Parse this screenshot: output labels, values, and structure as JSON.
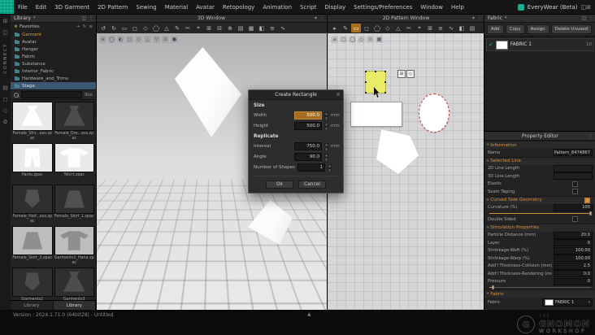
{
  "colors": {
    "accent_orange": "#d8913a",
    "brand_teal": "#0fb394",
    "selection_yellow": "#e8ec67",
    "dashed_red": "#c23a3a",
    "selection_blue": "#3b5774"
  },
  "menubar": {
    "items": [
      "File",
      "Edit",
      "3D Garment",
      "2D Pattern",
      "Sewing",
      "Material",
      "Avatar",
      "Retopology",
      "Animation",
      "Script",
      "Display",
      "Settings/Preferences",
      "Window",
      "Help"
    ],
    "app_title": "EveryWear (Beta)",
    "right_icons": [
      {
        "name": "workspace-layout",
        "glyph": "◫"
      },
      {
        "name": "window-expand",
        "glyph": "⊞"
      }
    ]
  },
  "left_rail": {
    "items": [
      {
        "name": "apps",
        "glyph": "⊞"
      },
      {
        "name": "panels",
        "glyph": "◫"
      },
      {
        "label": "CONNECT"
      },
      {
        "name": "library-rail",
        "glyph": "▤"
      },
      {
        "name": "viewport-rail",
        "glyph": "◻"
      },
      {
        "name": "assets-rail",
        "glyph": "◇"
      },
      {
        "name": "settings",
        "glyph": "⚙"
      }
    ]
  },
  "library": {
    "header": "Library",
    "header_caret": "▾",
    "header_icons": [
      {
        "name": "dock",
        "glyph": "◫"
      },
      {
        "name": "more",
        "glyph": "⋮"
      }
    ],
    "favorites_title": "Favorites",
    "favorites_icons": [
      {
        "name": "add-favorite",
        "glyph": "+"
      },
      {
        "name": "refresh",
        "glyph": "↻"
      },
      {
        "name": "list-view",
        "glyph": "≡"
      }
    ],
    "folders": [
      {
        "label": "Garment",
        "state": "active"
      },
      {
        "label": "Avatar"
      },
      {
        "label": "Hanger"
      },
      {
        "label": "Fabric"
      },
      {
        "label": "Substance"
      },
      {
        "label": "Interior_Fabric"
      },
      {
        "label": "Hardware_and_Trims"
      },
      {
        "label": "Stage",
        "state": "selected"
      }
    ],
    "search_icons": [
      {
        "name": "view-grid",
        "glyph": "⊞"
      },
      {
        "name": "sort",
        "glyph": "≡"
      }
    ],
    "items": [
      {
        "caption": "Female_Shir...ess.zpac",
        "bg": "#e9e9e9",
        "fg": "#fdfdfd",
        "shape": "dress"
      },
      {
        "caption": "Female_Dre...ess.zpac",
        "bg": "#2f2f2f",
        "fg": "#4d4d4d",
        "shape": "dress"
      },
      {
        "caption": "Pants.zpac",
        "bg": "#e9e9e9",
        "fg": "#fdfdfd",
        "shape": "pants"
      },
      {
        "caption": "Tshirt.zpac",
        "bg": "#e9e9e9",
        "fg": "#fdfdfd",
        "shape": "tee"
      },
      {
        "caption": "Female_Half...ess.zpac",
        "bg": "#2f2f2f",
        "fg": "#505050",
        "shape": "top"
      },
      {
        "caption": "Female_Skirt_1.zpac",
        "bg": "#2f2f2f",
        "fg": "#505050",
        "shape": "skirt"
      },
      {
        "caption": "Female_Skirt_2.zpac",
        "bg": "#bdbdbd",
        "fg": "#8f8f8f",
        "shape": "skirt"
      },
      {
        "caption": "Garments1_Hana.zpac",
        "bg": "#bdbdbd",
        "fg": "#8f8f8f",
        "shape": "tee"
      },
      {
        "caption": "Garments2",
        "bg": "#2f2f2f",
        "fg": "#4d4d4d",
        "shape": "top"
      },
      {
        "caption": "Garments3",
        "bg": "#2f2f2f",
        "fg": "#4d4d4d",
        "shape": "dress"
      }
    ],
    "tabs": [
      {
        "label": "Library",
        "active": false
      },
      {
        "label": "Library",
        "active": true
      }
    ]
  },
  "viewport3d": {
    "title": "3D Window",
    "title_icons": [
      {
        "name": "panel-menu",
        "glyph": "▾"
      },
      {
        "name": "panel-more",
        "glyph": "⋮"
      }
    ],
    "toolbar": [
      {
        "name": "undo",
        "glyph": "↺"
      },
      {
        "name": "redo",
        "glyph": "↻"
      },
      {
        "name": "rectangle-tool",
        "glyph": "▭"
      },
      {
        "name": "square-tool",
        "glyph": "◻"
      },
      {
        "name": "diamond-tool",
        "glyph": "◇"
      },
      {
        "name": "circle-tool",
        "glyph": "◯"
      },
      {
        "name": "triangle-tool",
        "glyph": "△"
      },
      {
        "name": "pen-tool",
        "glyph": "✎"
      },
      {
        "name": "scissors-tool",
        "glyph": "✂"
      },
      {
        "name": "target-tool",
        "glyph": "⌖"
      },
      {
        "name": "grid-view",
        "glyph": "⊞"
      },
      {
        "name": "collapse-view",
        "glyph": "⊟"
      },
      {
        "name": "add-view",
        "glyph": "⊕"
      },
      {
        "name": "rows-view",
        "glyph": "▤"
      },
      {
        "name": "mesh-view",
        "glyph": "▦"
      },
      {
        "name": "half-shade",
        "glyph": "◧"
      },
      {
        "name": "layers",
        "glyph": "≡"
      },
      {
        "name": "wave",
        "glyph": "∿"
      }
    ],
    "overlay": [
      {
        "name": "menu",
        "glyph": "≡"
      },
      {
        "name": "avatar-show",
        "glyph": "◯"
      },
      {
        "name": "avatar-half",
        "glyph": "◐"
      },
      {
        "name": "garment-show",
        "glyph": "◻"
      },
      {
        "name": "pattern-show",
        "glyph": "◇"
      },
      {
        "name": "pin-up",
        "glyph": "△"
      },
      {
        "name": "pin-down",
        "glyph": "▽"
      },
      {
        "name": "focus",
        "glyph": "⊙"
      },
      {
        "name": "render-dot",
        "glyph": "●"
      }
    ]
  },
  "viewport2d": {
    "title": "2D Pattern Window",
    "title_icons": [
      {
        "name": "panel-menu",
        "glyph": "▾"
      },
      {
        "name": "panel-more",
        "glyph": "⋮"
      }
    ],
    "toolbar": [
      {
        "name": "select-tool",
        "glyph": "▸"
      },
      {
        "name": "pen-tool",
        "glyph": "✎"
      },
      {
        "name": "rectangle-tool",
        "glyph": "▭",
        "active": true
      },
      {
        "name": "square-tool",
        "glyph": "◻"
      },
      {
        "name": "circle-tool",
        "glyph": "◯"
      },
      {
        "name": "diamond-tool",
        "glyph": "◇"
      },
      {
        "name": "triangle-tool",
        "glyph": "△"
      },
      {
        "name": "scissors-tool",
        "glyph": "✂"
      },
      {
        "name": "target-tool",
        "glyph": "⌖"
      },
      {
        "name": "grid-view",
        "glyph": "⊞"
      },
      {
        "name": "layers",
        "glyph": "≡"
      },
      {
        "name": "wave",
        "glyph": "∿"
      },
      {
        "name": "half-shade",
        "glyph": "◧"
      },
      {
        "name": "rows-view",
        "glyph": "▤"
      }
    ],
    "overlay": [
      {
        "name": "menu",
        "glyph": "≡"
      },
      {
        "name": "pattern-outline",
        "glyph": "◻"
      },
      {
        "name": "circle-show",
        "glyph": "◯"
      },
      {
        "name": "diamond-show",
        "glyph": "◇"
      },
      {
        "name": "focus",
        "glyph": "⊙"
      },
      {
        "name": "mesh-show",
        "glyph": "▦"
      }
    ],
    "gizmo_icons": [
      {
        "name": "scale-gizmo",
        "glyph": "⊞"
      },
      {
        "name": "rotate-gizmo",
        "glyph": "◇"
      }
    ]
  },
  "dialog": {
    "title": "Create Rectangle",
    "close": "×",
    "size_section": "Size",
    "width_label": "Width",
    "width_value": "500.0",
    "width_unit": "mm",
    "height_label": "Height",
    "height_value": "500.0",
    "height_unit": "mm",
    "replicate_section": "Replicate",
    "interval_label": "Interval",
    "interval_value": "750.0",
    "interval_unit": "mm",
    "angle_label": "Angle",
    "angle_value": "90.0",
    "angle_unit": "",
    "shapes_label": "Number of Shapes",
    "shapes_value": "1",
    "shapes_unit": "",
    "ok": "Ok",
    "cancel": "Cancel",
    "stepper_up": "▴",
    "stepper_down": "▾"
  },
  "right_panel": {
    "header": "Fabric",
    "header_caret": "▾",
    "header_icons": [
      {
        "name": "dock",
        "glyph": "◫"
      },
      {
        "name": "more",
        "glyph": "⋮"
      }
    ],
    "buttons": [
      "Add",
      "Copy",
      "Assign",
      "Delete Unused"
    ],
    "fabric_item": {
      "check": "✓",
      "name": "FABRIC 1",
      "count": "10"
    },
    "property_editor_title": "Property Editor",
    "property_editor_more": "⋮",
    "section_caret": "▾",
    "rows": [
      {
        "t": "sec",
        "label": "Information"
      },
      {
        "t": "field",
        "label": "Name",
        "value": "Pattern_8474867"
      },
      {
        "t": "sec",
        "label": "Selected Line"
      },
      {
        "t": "field",
        "label": "2D Line Length",
        "value": "",
        "disabled": true
      },
      {
        "t": "field",
        "label": "3D Line Length",
        "value": "",
        "disabled": true
      },
      {
        "t": "check",
        "label": "Elastic",
        "checked": false
      },
      {
        "t": "check",
        "label": "Seam Taping",
        "checked": false
      },
      {
        "t": "sec",
        "label": "Curved Side Geometry",
        "checked": true
      },
      {
        "t": "slider",
        "label": "Curvature (%)",
        "value": "100",
        "pos": 100
      },
      {
        "t": "check",
        "label": "Double Sided",
        "checked": false
      },
      {
        "t": "sec",
        "label": "Simulation Properties"
      },
      {
        "t": "field",
        "label": "Particle Distance (mm)",
        "value": "20.0"
      },
      {
        "t": "field",
        "label": "Layer",
        "value": "0"
      },
      {
        "t": "field",
        "label": "Shrinkage-Weft (%)",
        "value": "100.00"
      },
      {
        "t": "field",
        "label": "Shrinkage-Warp (%)",
        "value": "100.00"
      },
      {
        "t": "field",
        "label": "Add'l Thickness-Collision (mm)",
        "value": "2.5"
      },
      {
        "t": "field",
        "label": "Add'l Thickness-Rendering (mm)",
        "value": "0.0"
      },
      {
        "t": "slider",
        "label": "Pressure",
        "value": "0",
        "pos": 4
      },
      {
        "t": "sec",
        "label": "Fabric"
      },
      {
        "t": "fabric",
        "label": "Fabric",
        "value": "FABRIC 1",
        "caret": "▾"
      }
    ]
  },
  "statusbar": {
    "version": "Version : 2024.1.71.0 (64bit28) - Untitled",
    "expander": "▲"
  },
  "watermark": {
    "circle_letter": "G",
    "the": "THE",
    "gnomon": "GNOMON",
    "workshop": "WORKSHOP"
  }
}
